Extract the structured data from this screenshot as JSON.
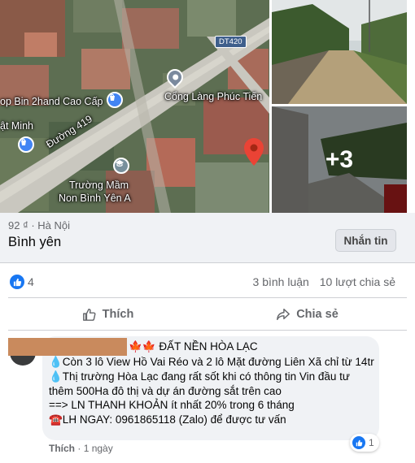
{
  "map": {
    "labels": {
      "shop": "op Bin 2hand Cao Cấp",
      "gate": "Cổng Làng Phúc Tiến",
      "minh": "ật Minh",
      "road": "Đường 419",
      "school_line1": "Trường Mầm",
      "school_line2": "Non Bình Yên A",
      "route": "DT420"
    }
  },
  "photos": {
    "more_count": "+3"
  },
  "listing": {
    "price_location": "92 ₫ · Hà Nội",
    "title": "Bình yên",
    "message_button": "Nhắn tin"
  },
  "stats": {
    "like_count": "4",
    "comments": "3 bình luận",
    "shares": "10 lượt chia sẻ"
  },
  "actions": {
    "like": "Thích",
    "share": "Chia sẻ"
  },
  "comment": {
    "header": "🍁🍁 ĐẤT NỀN HÒA LẠC",
    "lines": [
      "💧Còn 3 lô View Hồ Vai Réo và 2 lô Mặt đường Liên Xã chỉ từ 14tr",
      "💧Thị trường Hòa Lạc đang rất sốt khi có thông tin Vin đầu tư thêm 500Ha đô thị và dự án đường sắt trên cao",
      "==> LN THANH KHOẢN ít nhất 20% trong 6 tháng",
      "☎️LH NGAY: 0961865118 (Zalo) để được tư vấn"
    ],
    "like_link": "Thích",
    "time": "1 ngày",
    "reaction_count": "1"
  },
  "colors": {
    "facebook_blue": "#1877f2",
    "pin_red": "#ea4335",
    "pin_blue": "#4285f4",
    "secondary_text": "#65676b"
  }
}
